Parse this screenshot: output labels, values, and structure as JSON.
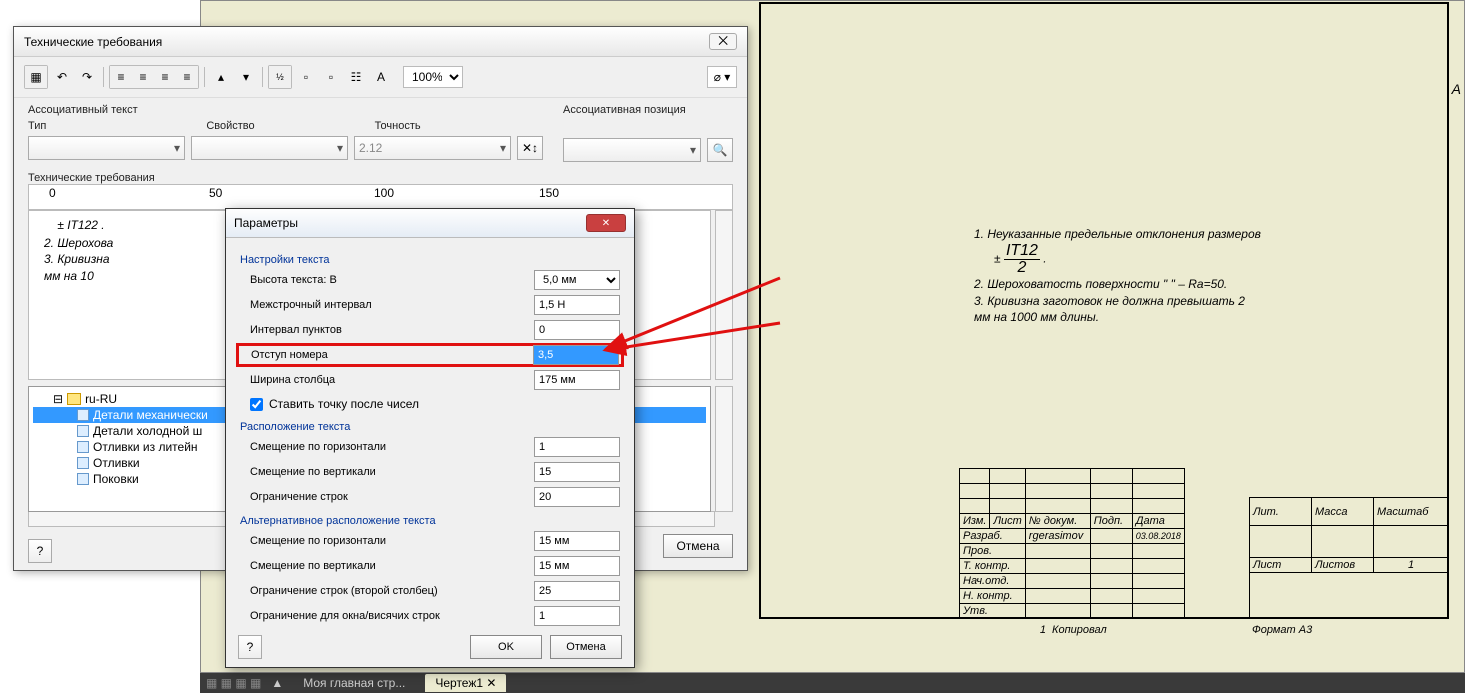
{
  "main_dialog": {
    "title": "Технические требования",
    "close": "⨉",
    "zoom": "100%",
    "assoc_text_label": "Ассоциативный текст",
    "assoc_pos_label": "Ассоциативная позиция",
    "type_label": "Тип",
    "property_label": "Свойство",
    "precision_label": "Точность",
    "precision_value": "2.12",
    "req_label": "Технические требования",
    "editor_lines": [
      "2.   Шерохова",
      "3.   Кривизна",
      "      мм на 10"
    ],
    "tree": {
      "root": "ru-RU",
      "items": [
        "Детали механически",
        "Детали холодной ш",
        "Отливки из литейн",
        "Отливки",
        "Поковки"
      ]
    },
    "cancel": "Отмена"
  },
  "params_dialog": {
    "title": "Параметры",
    "group1": "Настройки текста",
    "text_height_label": "Высота текста: B",
    "text_height_value": "5,0 мм",
    "line_spacing_label": "Межстрочный интервал",
    "line_spacing_value": "1,5 H",
    "item_spacing_label": "Интервал пунктов",
    "item_spacing_value": "0",
    "number_indent_label": "Отступ номера",
    "number_indent_value": "3,5",
    "col_width_label": "Ширина столбца",
    "col_width_value": "175 мм",
    "dot_after_label": "Ставить точку после чисел",
    "group2": "Расположение текста",
    "h_offset_label": "Смещение по горизонтали",
    "h_offset_value": "1",
    "v_offset_label": "Смещение по вертикали",
    "v_offset_value": "15",
    "row_limit_label": "Ограничение строк",
    "row_limit_value": "20",
    "group3": "Альтернативное расположение текста",
    "alt_h_offset_label": "Смещение по горизонтали",
    "alt_h_offset_value": "15 мм",
    "alt_v_offset_label": "Смещение по вертикали",
    "alt_v_offset_value": "15 мм",
    "alt_row_limit_label": "Ограничение строк (второй столбец)",
    "alt_row_limit_value": "25",
    "orphan_label": "Ограничение для окна/висячих строк",
    "orphan_value": "1",
    "ok": "OK",
    "cancel": "Отмена"
  },
  "drawing": {
    "format_label": "A",
    "req1": "1.    Неуказанные предельные отклонения размеров",
    "req1b": "      ±",
    "frac_num": "IT12",
    "frac_den": "2",
    "req2": "2.    Шероховатость поверхности \" \" – Ra=50.",
    "req3": "3.    Кривизна заготовок не должна превышать 2",
    "req3b": "      мм на 1000 мм длины.",
    "titleblock": {
      "headers": [
        "Изм.",
        "Лист",
        "№ докум.",
        "Подп.",
        "Дата"
      ],
      "rows": [
        [
          "Разраб.",
          "rgerasimov",
          "",
          "03.08.2018"
        ],
        [
          "Пров.",
          "",
          "",
          ""
        ],
        [
          "Т. контр.",
          "",
          "",
          ""
        ],
        [
          "Нач.отд.",
          "",
          "",
          ""
        ],
        [
          "Н. контр.",
          "",
          "",
          ""
        ],
        [
          "Утв.",
          "",
          "",
          ""
        ]
      ],
      "right_headers": [
        "Лит.",
        "Масса",
        "Масштаб"
      ],
      "sheet": "Лист",
      "sheets": "Листов",
      "sheets_val": "1",
      "bottom_num": "1",
      "copied": "Копировал",
      "format": "Формат A3"
    }
  },
  "taskbar": {
    "tab1": "Моя главная стр...",
    "tab2": "Чертеж1"
  }
}
